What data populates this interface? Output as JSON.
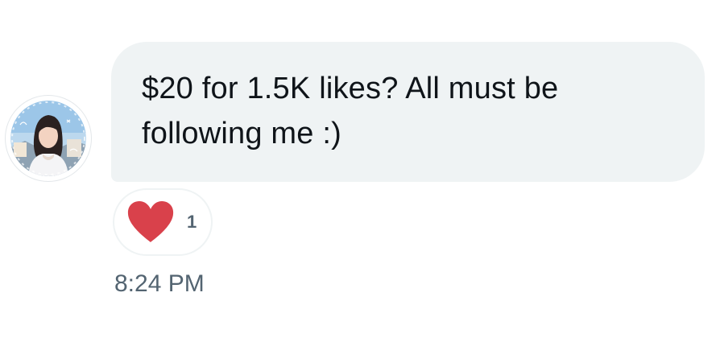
{
  "message": {
    "text": "$20 for 1.5K likes? All must be\nfollowing me :)",
    "timestamp": "8:24 PM"
  },
  "reaction": {
    "icon": "heart-icon",
    "count": "1",
    "color": "#d9414b"
  },
  "colors": {
    "bubble_background": "#eff3f4",
    "text": "#0f1419",
    "secondary_text": "#536471"
  }
}
